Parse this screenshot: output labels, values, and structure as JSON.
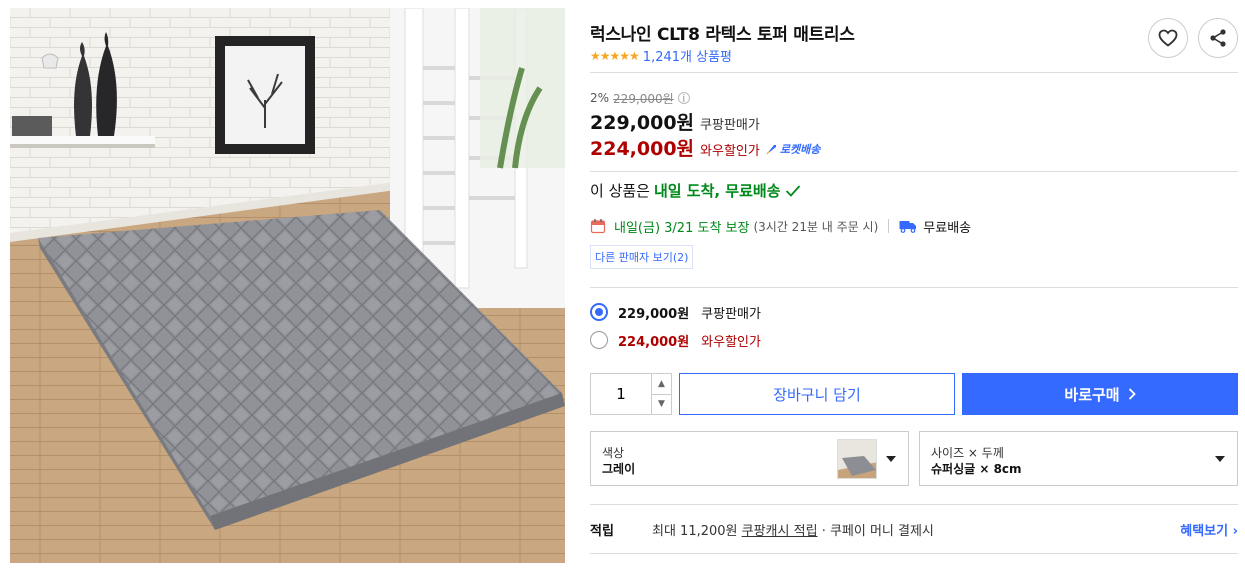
{
  "product": {
    "title": "럭스나인 CLT8 라텍스 토퍼 매트리스",
    "stars": "★★★★★",
    "review_count": "1,241개 상품평"
  },
  "price": {
    "discount_rate": "2%",
    "original_price": "229,000원",
    "coupang_price": "229,000원",
    "coupang_price_label": "쿠팡판매가",
    "wow_price": "224,000원",
    "wow_price_label": "와우할인가",
    "rocket_badge": "로켓배송"
  },
  "delivery": {
    "headline_prefix": "이 상품은",
    "headline_highlight": "내일 도착, 무료배송",
    "eta": "내일(금) 3/21 도착 보장",
    "eta_note": "(3시간 21분 내 주문 시)",
    "free_shipping": "무료배송",
    "other_sellers": "다른 판매자 보기(2)"
  },
  "options": [
    {
      "price": "229,000원",
      "label": "쿠팡판매가",
      "selected": true
    },
    {
      "price": "224,000원",
      "label": "와우할인가",
      "selected": false
    }
  ],
  "purchase": {
    "quantity": "1",
    "cart_label": "장바구니 담기",
    "buy_label": "바로구매"
  },
  "selectors": {
    "color_label": "색상",
    "color_value": "그레이",
    "size_label": "사이즈 × 두께",
    "size_value": "슈퍼싱글 × 8cm"
  },
  "reward": {
    "label": "적립",
    "text_prefix": "최대 11,200원",
    "text_link": "쿠팡캐시 적립",
    "text_suffix": "· 쿠페이 머니 결제시",
    "more_label": "혜택보기 ›"
  },
  "colors": {
    "accent_blue": "#346aff",
    "sale_red": "#ae0000",
    "delivery_green": "#00891a",
    "star_orange": "#f5a623"
  },
  "icons": [
    "heart-icon",
    "share-icon",
    "info-icon",
    "rocket-icon",
    "check-icon",
    "calendar-icon",
    "truck-icon",
    "chevron-right-icon",
    "caret-down-icon"
  ]
}
